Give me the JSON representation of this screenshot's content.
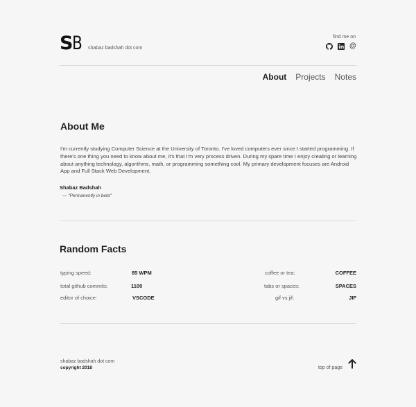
{
  "header": {
    "logo_s": "S",
    "logo_b": "B",
    "site_name": "shabaz badshah dot com",
    "find_me": "find me on",
    "social_icons": [
      "github-icon",
      "linkedin-icon",
      "at-icon"
    ],
    "at_symbol": "@"
  },
  "nav": {
    "items": [
      {
        "label": "About",
        "active": true
      },
      {
        "label": "Projects",
        "active": false
      },
      {
        "label": "Notes",
        "active": false
      }
    ]
  },
  "about": {
    "heading": "About Me",
    "body": "I'm currently studying Computer Science at the University of Toronto. I've loved computers ever since I started programming. If there's one thing you need to know about me, it's that I'm very process driven. During my spare time I enjoy creating or learning about anything technology, algorithms, math, or programming something cool. My primary development focuses are Android App and Full Stack Web Development.",
    "author": "Shabaz Badshah",
    "quote": "— \"Permanently in beta\""
  },
  "facts": {
    "heading": "Random Facts",
    "left": [
      {
        "label": "typing speed:",
        "value": "85 WPM"
      },
      {
        "label": "total github commits:",
        "value": "1100"
      },
      {
        "label": "editor of choice:",
        "value": "VSCODE"
      }
    ],
    "right": [
      {
        "label": "coffee or tea:",
        "value": "COFFEE"
      },
      {
        "label": "tabs or spaces:",
        "value": "SPACES"
      },
      {
        "label": "gif vs jif:",
        "value": "JIF"
      }
    ]
  },
  "footer": {
    "site_name": "shabaz badshah dot com",
    "copyright": "copyright 2018",
    "top_link": "top of page"
  }
}
